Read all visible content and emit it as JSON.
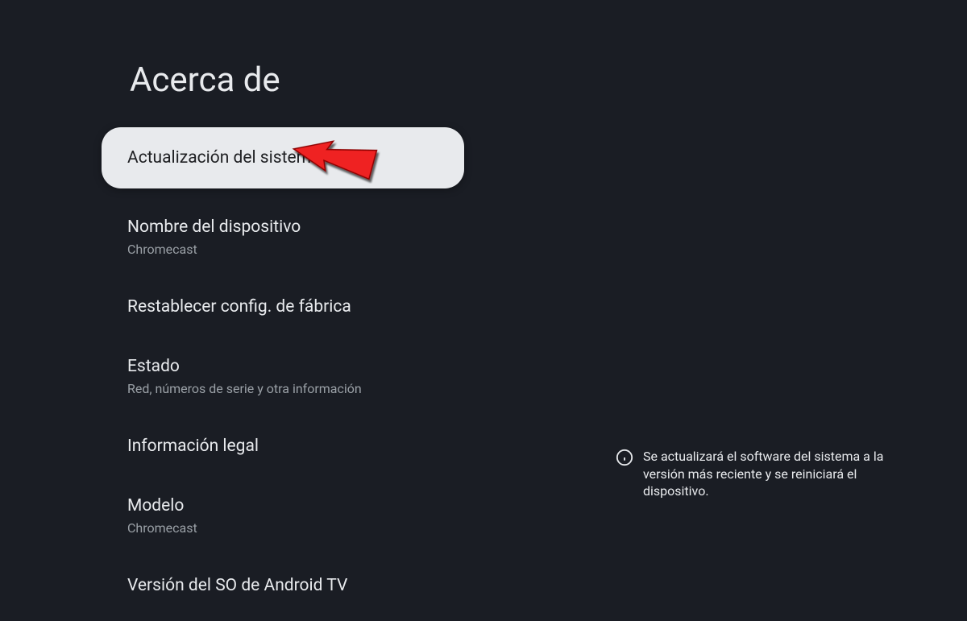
{
  "page": {
    "title": "Acerca de"
  },
  "menu": {
    "items": [
      {
        "label": "Actualización del sistema",
        "sublabel": null,
        "selected": true
      },
      {
        "label": "Nombre del dispositivo",
        "sublabel": "Chromecast",
        "selected": false
      },
      {
        "label": "Restablecer config. de fábrica",
        "sublabel": null,
        "selected": false
      },
      {
        "label": "Estado",
        "sublabel": "Red, números de serie y otra información",
        "selected": false
      },
      {
        "label": "Información legal",
        "sublabel": null,
        "selected": false
      },
      {
        "label": "Modelo",
        "sublabel": "Chromecast",
        "selected": false
      },
      {
        "label": "Versión del SO de Android TV",
        "sublabel": null,
        "selected": false
      }
    ]
  },
  "info": {
    "text": "Se actualizará el software del sistema a la versión más reciente y se reiniciará el dispositivo."
  }
}
